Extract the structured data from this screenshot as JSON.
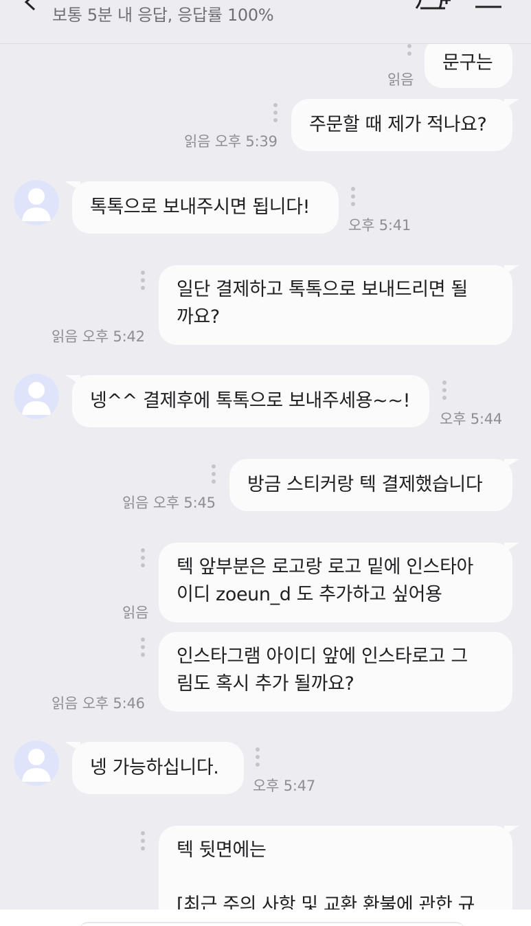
{
  "header": {
    "status": "보통 5분 내 응답, 응답률 100%"
  },
  "messages": {
    "m0": {
      "text": "문구는",
      "meta": "읽음"
    },
    "m1": {
      "text": "주문할 때 제가 적나요?",
      "meta": "읽음 오후 5:39"
    },
    "m2": {
      "text": "톡톡으로 보내주시면 됩니다!",
      "meta": "오후 5:41"
    },
    "m3": {
      "line1": "일단 결제하고 톡톡으로 보내드리면 될",
      "line2": "까요?",
      "meta": "읽음 오후 5:42"
    },
    "m4": {
      "text": "넹^^ 결제후에 톡톡으로 보내주세용~~!",
      "meta": "오후 5:44"
    },
    "m5": {
      "text": "방금 스티커랑 텍 결제했습니다",
      "meta": "읽음 오후 5:45"
    },
    "m6": {
      "line1": "텍 앞부분은 로고랑 로고 밑에 인스타아",
      "line2": "이디 zoeun_d 도 추가하고 싶어용",
      "meta": "읽음"
    },
    "m7": {
      "line1": "인스타그램 아이디 앞에 인스타로고 그",
      "line2": "림도 혹시 추가 될까요?",
      "meta": "읽음 오후 5:46"
    },
    "m8": {
      "text": "넹 가능하십니다.",
      "meta": "오후 5:47"
    },
    "m9": {
      "line1": "텍 뒷면에는",
      "line3": "[최근 주의 사항 및 교환 환불에 관한 규"
    }
  },
  "colors": {
    "background": "#ededf1",
    "bubble": "#fbfbfc",
    "meta_text": "#8d8d93",
    "avatar_bg": "#dfe4fb"
  }
}
